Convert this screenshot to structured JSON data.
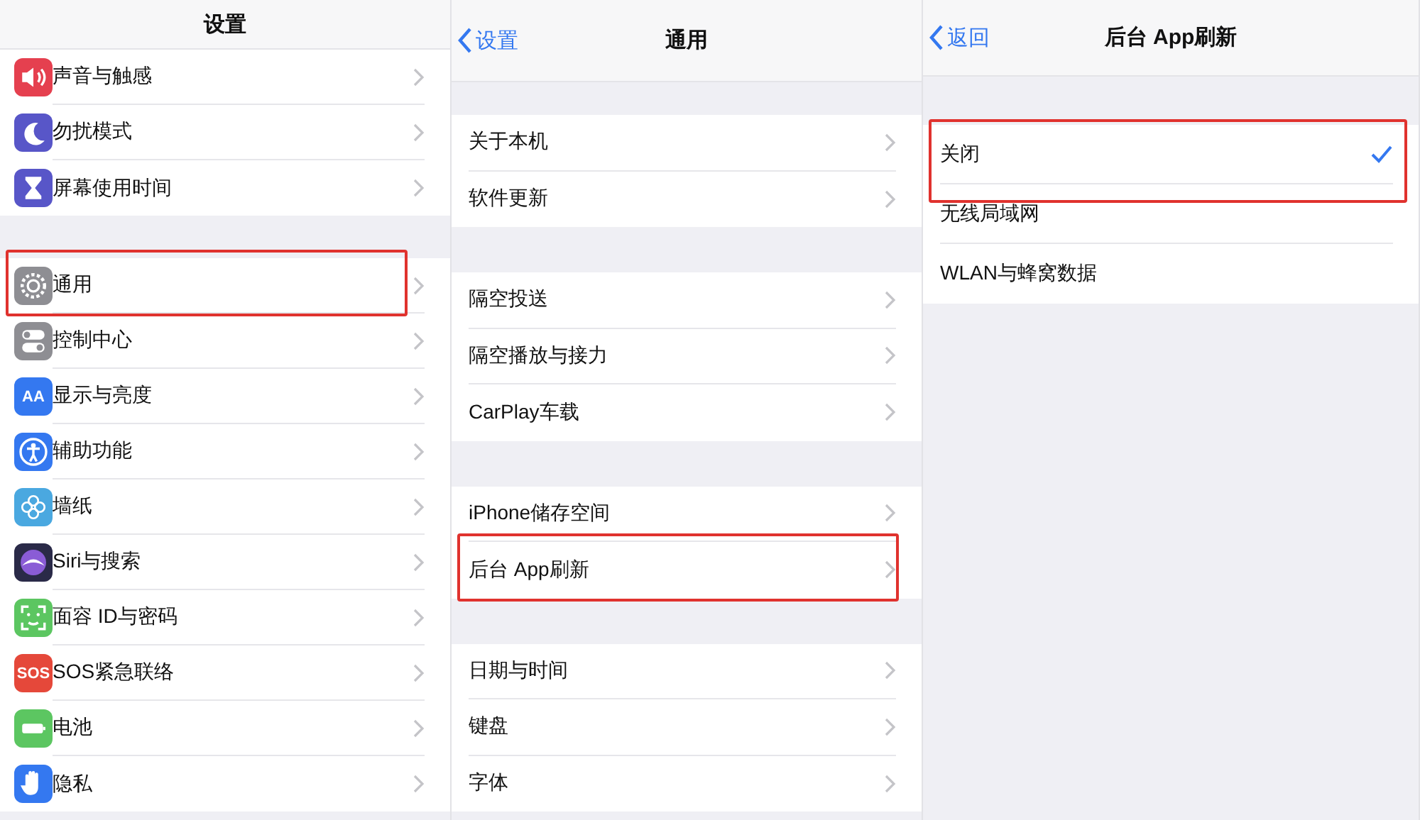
{
  "panels": [
    {
      "title": "设置",
      "groups": [
        {
          "rows": [
            {
              "label": "声音与触感",
              "color": "#e5404f",
              "highlighted": false
            },
            {
              "label": "勿扰模式",
              "color": "#5856c8",
              "highlighted": false
            },
            {
              "label": "屏幕使用时间",
              "color": "#5856c8",
              "highlighted": false
            }
          ]
        },
        {
          "rows": [
            {
              "label": "通用",
              "color": "#8e8e93",
              "highlighted": true
            },
            {
              "label": "控制中心",
              "color": "#8e8e93",
              "highlighted": false
            },
            {
              "label": "显示与亮度",
              "color": "#3478f0",
              "badge": "AA",
              "highlighted": false
            },
            {
              "label": "辅助功能",
              "color": "#3478f0",
              "highlighted": false
            },
            {
              "label": "墙纸",
              "color": "#4aa8e0",
              "highlighted": false
            },
            {
              "label": "Siri与搜索",
              "color": "#2a2a48",
              "highlighted": false
            },
            {
              "label": "面容 ID与密码",
              "color": "#5cc661",
              "highlighted": false
            },
            {
              "label": "SOS紧急联络",
              "color": "#e5483a",
              "badge": "SOS",
              "highlighted": false
            },
            {
              "label": "电池",
              "color": "#5cc661",
              "highlighted": false
            },
            {
              "label": "隐私",
              "color": "#3478f0",
              "highlighted": false
            }
          ]
        }
      ]
    },
    {
      "back": "设置",
      "title": "通用",
      "groups": [
        {
          "rows": [
            {
              "label": "关于本机",
              "highlighted": false
            },
            {
              "label": "软件更新",
              "highlighted": false
            }
          ]
        },
        {
          "rows": [
            {
              "label": "隔空投送",
              "highlighted": false
            },
            {
              "label": "隔空播放与接力",
              "highlighted": false
            },
            {
              "label": "CarPlay车载",
              "highlighted": false
            }
          ]
        },
        {
          "rows": [
            {
              "label": "iPhone储存空间",
              "highlighted": false
            },
            {
              "label": "后台 App刷新",
              "highlighted": true
            }
          ]
        },
        {
          "rows": [
            {
              "label": "日期与时间",
              "highlighted": false
            },
            {
              "label": "键盘",
              "highlighted": false
            },
            {
              "label": "字体",
              "highlighted": false
            }
          ]
        }
      ]
    },
    {
      "back": "返回",
      "title": "后台 App刷新",
      "options": [
        {
          "label": "关闭",
          "selected": true,
          "highlighted": true
        },
        {
          "label": "无线局域网",
          "selected": false,
          "highlighted": false
        },
        {
          "label": "WLAN与蜂窝数据",
          "selected": false,
          "highlighted": false
        }
      ]
    }
  ]
}
